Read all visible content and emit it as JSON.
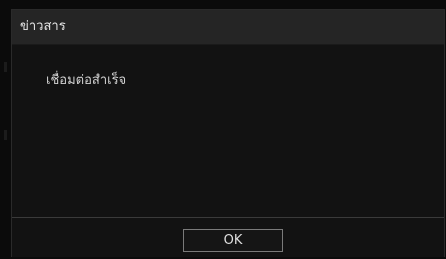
{
  "dialog": {
    "title": "ข่าวสาร",
    "message": "เชื่อมต่อสำเร็จ",
    "ok_label": "OK"
  },
  "colors": {
    "titlebar_bg": "#252525",
    "dialog_bg": "#121212",
    "button_border": "#7a7a7a"
  }
}
